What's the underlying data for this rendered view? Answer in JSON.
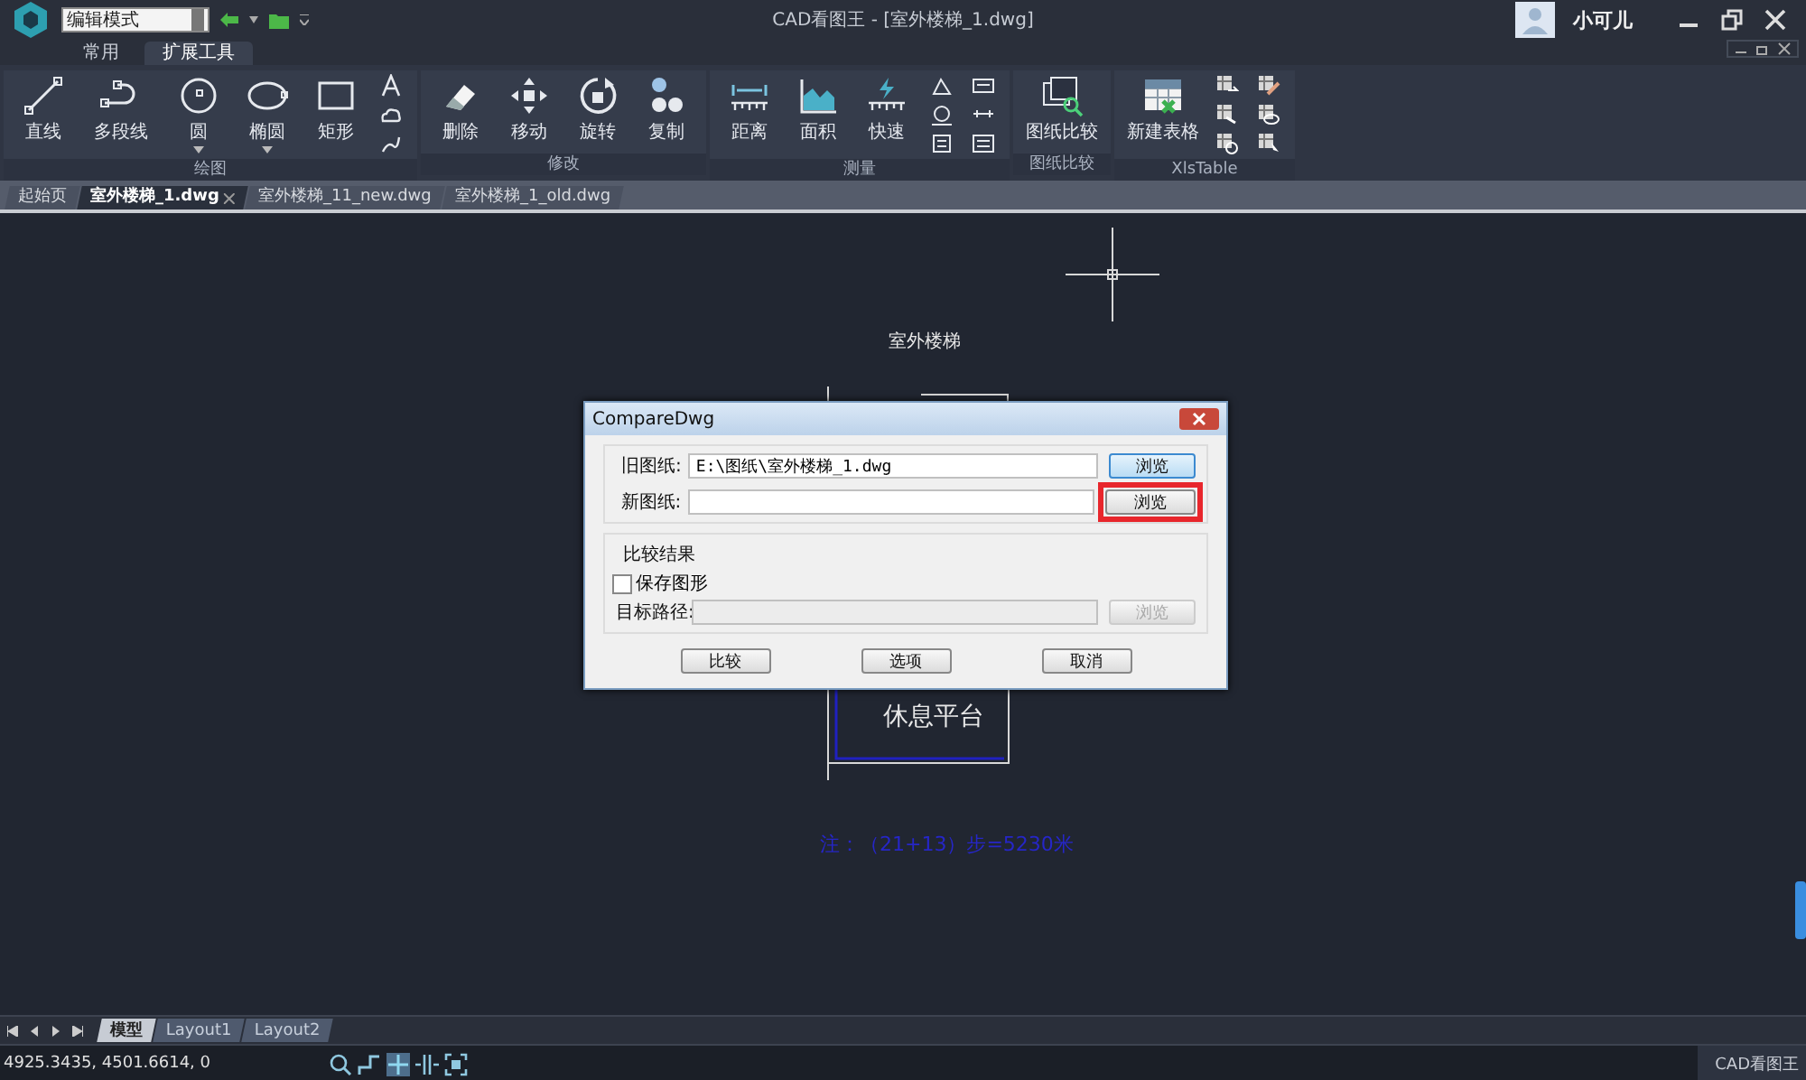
{
  "window": {
    "title": "CAD看图王 - [室外楼梯_1.dwg]",
    "mode_field": {
      "value": "编辑模式"
    },
    "user": "小可儿"
  },
  "ribbon_tabs": [
    {
      "label": "常用",
      "selected": false
    },
    {
      "label": "扩展工具",
      "selected": true
    }
  ],
  "ribbon_groups": [
    {
      "kind": "draw",
      "title": "绘图",
      "tools": [
        {
          "label": "直线",
          "dropdown": false
        },
        {
          "label": "多段线",
          "dropdown": false
        },
        {
          "label": "圆",
          "dropdown": true
        },
        {
          "label": "椭圆",
          "dropdown": true
        },
        {
          "label": "矩形",
          "dropdown": false
        }
      ]
    },
    {
      "kind": "modify",
      "title": "修改",
      "tools": [
        {
          "label": "删除",
          "dropdown": false
        },
        {
          "label": "移动",
          "dropdown": false
        },
        {
          "label": "旋转",
          "dropdown": false
        },
        {
          "label": "复制",
          "dropdown": false
        }
      ]
    },
    {
      "kind": "measure",
      "title": "测量",
      "tools": [
        {
          "label": "距离",
          "dropdown": false
        },
        {
          "label": "面积",
          "dropdown": false
        },
        {
          "label": "快速",
          "dropdown": false
        }
      ]
    },
    {
      "kind": "compare",
      "title": "图纸比较",
      "tools": [
        {
          "label": "图纸比较",
          "dropdown": false
        }
      ]
    },
    {
      "kind": "table",
      "title": "XlsTable",
      "tools": [
        {
          "label": "新建表格",
          "dropdown": false
        }
      ]
    }
  ],
  "doc_tabs": [
    {
      "label": "起始页",
      "selected": false
    },
    {
      "label": "室外楼梯_1.dwg",
      "selected": true
    },
    {
      "label": "室外楼梯_11_new.dwg",
      "selected": false
    },
    {
      "label": "室外楼梯_1_old.dwg",
      "selected": false
    }
  ],
  "drawing": {
    "title": "室外楼梯",
    "platform_label": "休息平台",
    "note": "注：（21+13）步=5230米"
  },
  "dialog": {
    "title": "CompareDwg",
    "files": [
      {
        "label": "旧图纸:",
        "value": "E:\\图纸\\室外楼梯_1.dwg",
        "button": "浏览",
        "focused": true,
        "highlighted": false
      },
      {
        "label": "新图纸:",
        "button": "浏览",
        "focused": false,
        "highlighted": true
      }
    ],
    "result": {
      "title": "比较结果",
      "checkbox": {
        "label": "保存图形",
        "checked": false
      },
      "target": {
        "label": "目标路径:",
        "button": "浏览",
        "disabled": true
      }
    },
    "buttons": [
      "比较",
      "选项",
      "取消"
    ]
  },
  "layout_tabs": [
    {
      "label": "模型",
      "selected": true
    },
    {
      "label": "Layout1",
      "selected": false
    },
    {
      "label": "Layout2",
      "selected": false
    }
  ],
  "status_bar": {
    "coordinates": "4925.3435, 4501.6614, 0",
    "app_label": "CAD看图王"
  }
}
